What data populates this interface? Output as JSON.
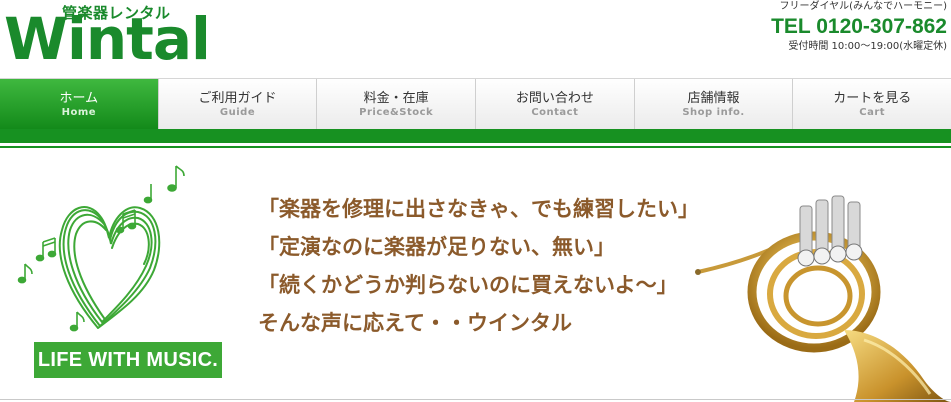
{
  "header": {
    "logo_sub": "管楽器レンタル",
    "logo_main": "Wintal",
    "free_dial": "フリーダイヤル(みんなでハーモニー)",
    "tel": "TEL 0120-307-862",
    "hours": "受付時間 10:00〜19:00(水曜定休)"
  },
  "nav": {
    "items": [
      {
        "label": "ホーム",
        "sub": "Home"
      },
      {
        "label": "ご利用ガイド",
        "sub": "Guide"
      },
      {
        "label": "料金・在庫",
        "sub": "Price&Stock"
      },
      {
        "label": "お問い合わせ",
        "sub": "Contact"
      },
      {
        "label": "店舗情報",
        "sub": "Shop info."
      },
      {
        "label": "カートを見る",
        "sub": "Cart"
      }
    ],
    "active_index": 0
  },
  "hero": {
    "badge": "LIFE WITH MUSIC.",
    "quotes": [
      "「楽器を修理に出さなきゃ、でも練習したい」",
      "「定演なのに楽器が足りない、無い」",
      "「続くかどうか判らないのに買えないよ〜」",
      "そんな声に応えて・・ウインタル"
    ]
  },
  "colors": {
    "brand_green": "#1a8a2c",
    "bar_green": "#179121",
    "quote_brown": "#8b5a2b"
  },
  "icons": {
    "heart": "heart-scribble-icon",
    "notes": "music-note-icon",
    "horn": "french-horn-image"
  }
}
